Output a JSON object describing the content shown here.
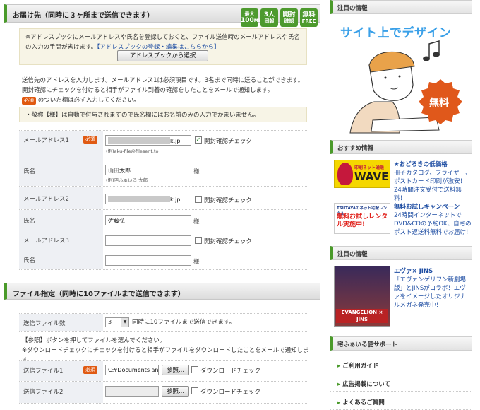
{
  "delivery": {
    "title": "お届け先（同時に３ヶ所まで送信できます）",
    "badges": [
      {
        "top": "最大",
        "main": "100",
        "unit": "MB"
      },
      {
        "top": "3人",
        "main": "同報",
        "unit": ""
      },
      {
        "top": "開封",
        "main": "確認",
        "unit": ""
      },
      {
        "top": "無料",
        "main": "FREE",
        "unit": ""
      }
    ],
    "addressbook_note": "※アドレスブックにメールアドレスや氏名を登録しておくと、ファイル送信時のメールアドレスや氏名の入力の手間が省けます。",
    "addressbook_link": "【アドレスブックの登録・編集はこちらから】",
    "addressbook_button": "アドレスブックから選択",
    "instructions_line1": "送信先のアドレスを入力します。メールアドレス1は必須項目です。3名まで同時に送ることができます。",
    "instructions_line2": "開封確認にチェックを付けると相手がファイル到着の確認をしたことをメールで通知します。",
    "required_badge": "必須",
    "instructions_line3": "のついた欄は必ず入力してください。",
    "honorific_note": "・敬称【様】は自動で付与されますので氏名欄にはお名前のみの入力でかまいません。",
    "rows": {
      "email1_label": "メールアドレス1",
      "email1_value": "k.jp",
      "email1_hint": "(例)aku-file@filesent.to",
      "name1_label": "氏名",
      "name1_value": "山田太郎",
      "name1_hint": "(例)宅ふぁいる 太郎",
      "email2_label": "メールアドレス2",
      "email2_value": "k.jp",
      "name2_label": "氏名",
      "name2_value": "佐藤弘",
      "email3_label": "メールアドレス3",
      "email3_value": "",
      "name3_label": "氏名",
      "name3_value": "",
      "sama": "様",
      "open_check_label": "開封確認チェック",
      "email1_checked": true,
      "email2_checked": false,
      "email3_checked": false
    }
  },
  "files": {
    "title": "ファイル指定（同時に10ファイルまで送信できます）",
    "count_label": "送信ファイル数",
    "count_value": "3",
    "count_note": "同時に10ファイルまで送信できます。",
    "help_line1": "【参照】ボタンを押してファイルを選んでください。",
    "help_line2": "※ダウンロードチェックにチェックを付けると相手がファイルをダウンロードしたことをメールで通知します。",
    "file1_label": "送信ファイル1",
    "file1_value": "C:¥Documents and",
    "file2_label": "送信ファイル2",
    "file2_value": "",
    "browse_button": "参照...",
    "download_check_label": "ダウンロードチェック",
    "required_badge": "必須"
  },
  "sidebar": {
    "featured_title": "注目の情報",
    "banner_title": "サイト上でデザイン",
    "banner_free": "無料",
    "recommend_title": "おすすめ情報",
    "promo1_title": "★おどろきの低価格",
    "promo1_body": "冊子カタログ、フライヤー、ポストカード印刷が激安！24時間注文受付で送料無料！",
    "promo1_logo_top": "印刷ネット通販",
    "promo1_logo": "WAVE",
    "promo2_title": "無料お試しキャンペーン",
    "promo2_body": "24時間インターネットでDVD&CDの予約OK、自宅のポスト返送料無料でお届け!",
    "promo2_logo_top": "TSUTAYAのネット宅配レンタル",
    "promo2_logo": "無料お試しレンタル実施中!",
    "featured2_title": "注目の情報",
    "promo3_title": "エヴァ× JINS",
    "promo3_body": "「エヴァンゲリヲン新劇場版」とJINSがコラボ！エヴァをイメージしたオリジナルメガネ発売中！",
    "promo3_logo": "EVANGELION × JINS",
    "support_title": "宅ふぁいる便サポート",
    "links": [
      "ご利用ガイド",
      "広告掲載について",
      "よくあるご質問"
    ]
  },
  "colors": {
    "brand_green": "#4a9a2a",
    "required_orange": "#e05a12",
    "link_blue": "#1f4ea3"
  }
}
